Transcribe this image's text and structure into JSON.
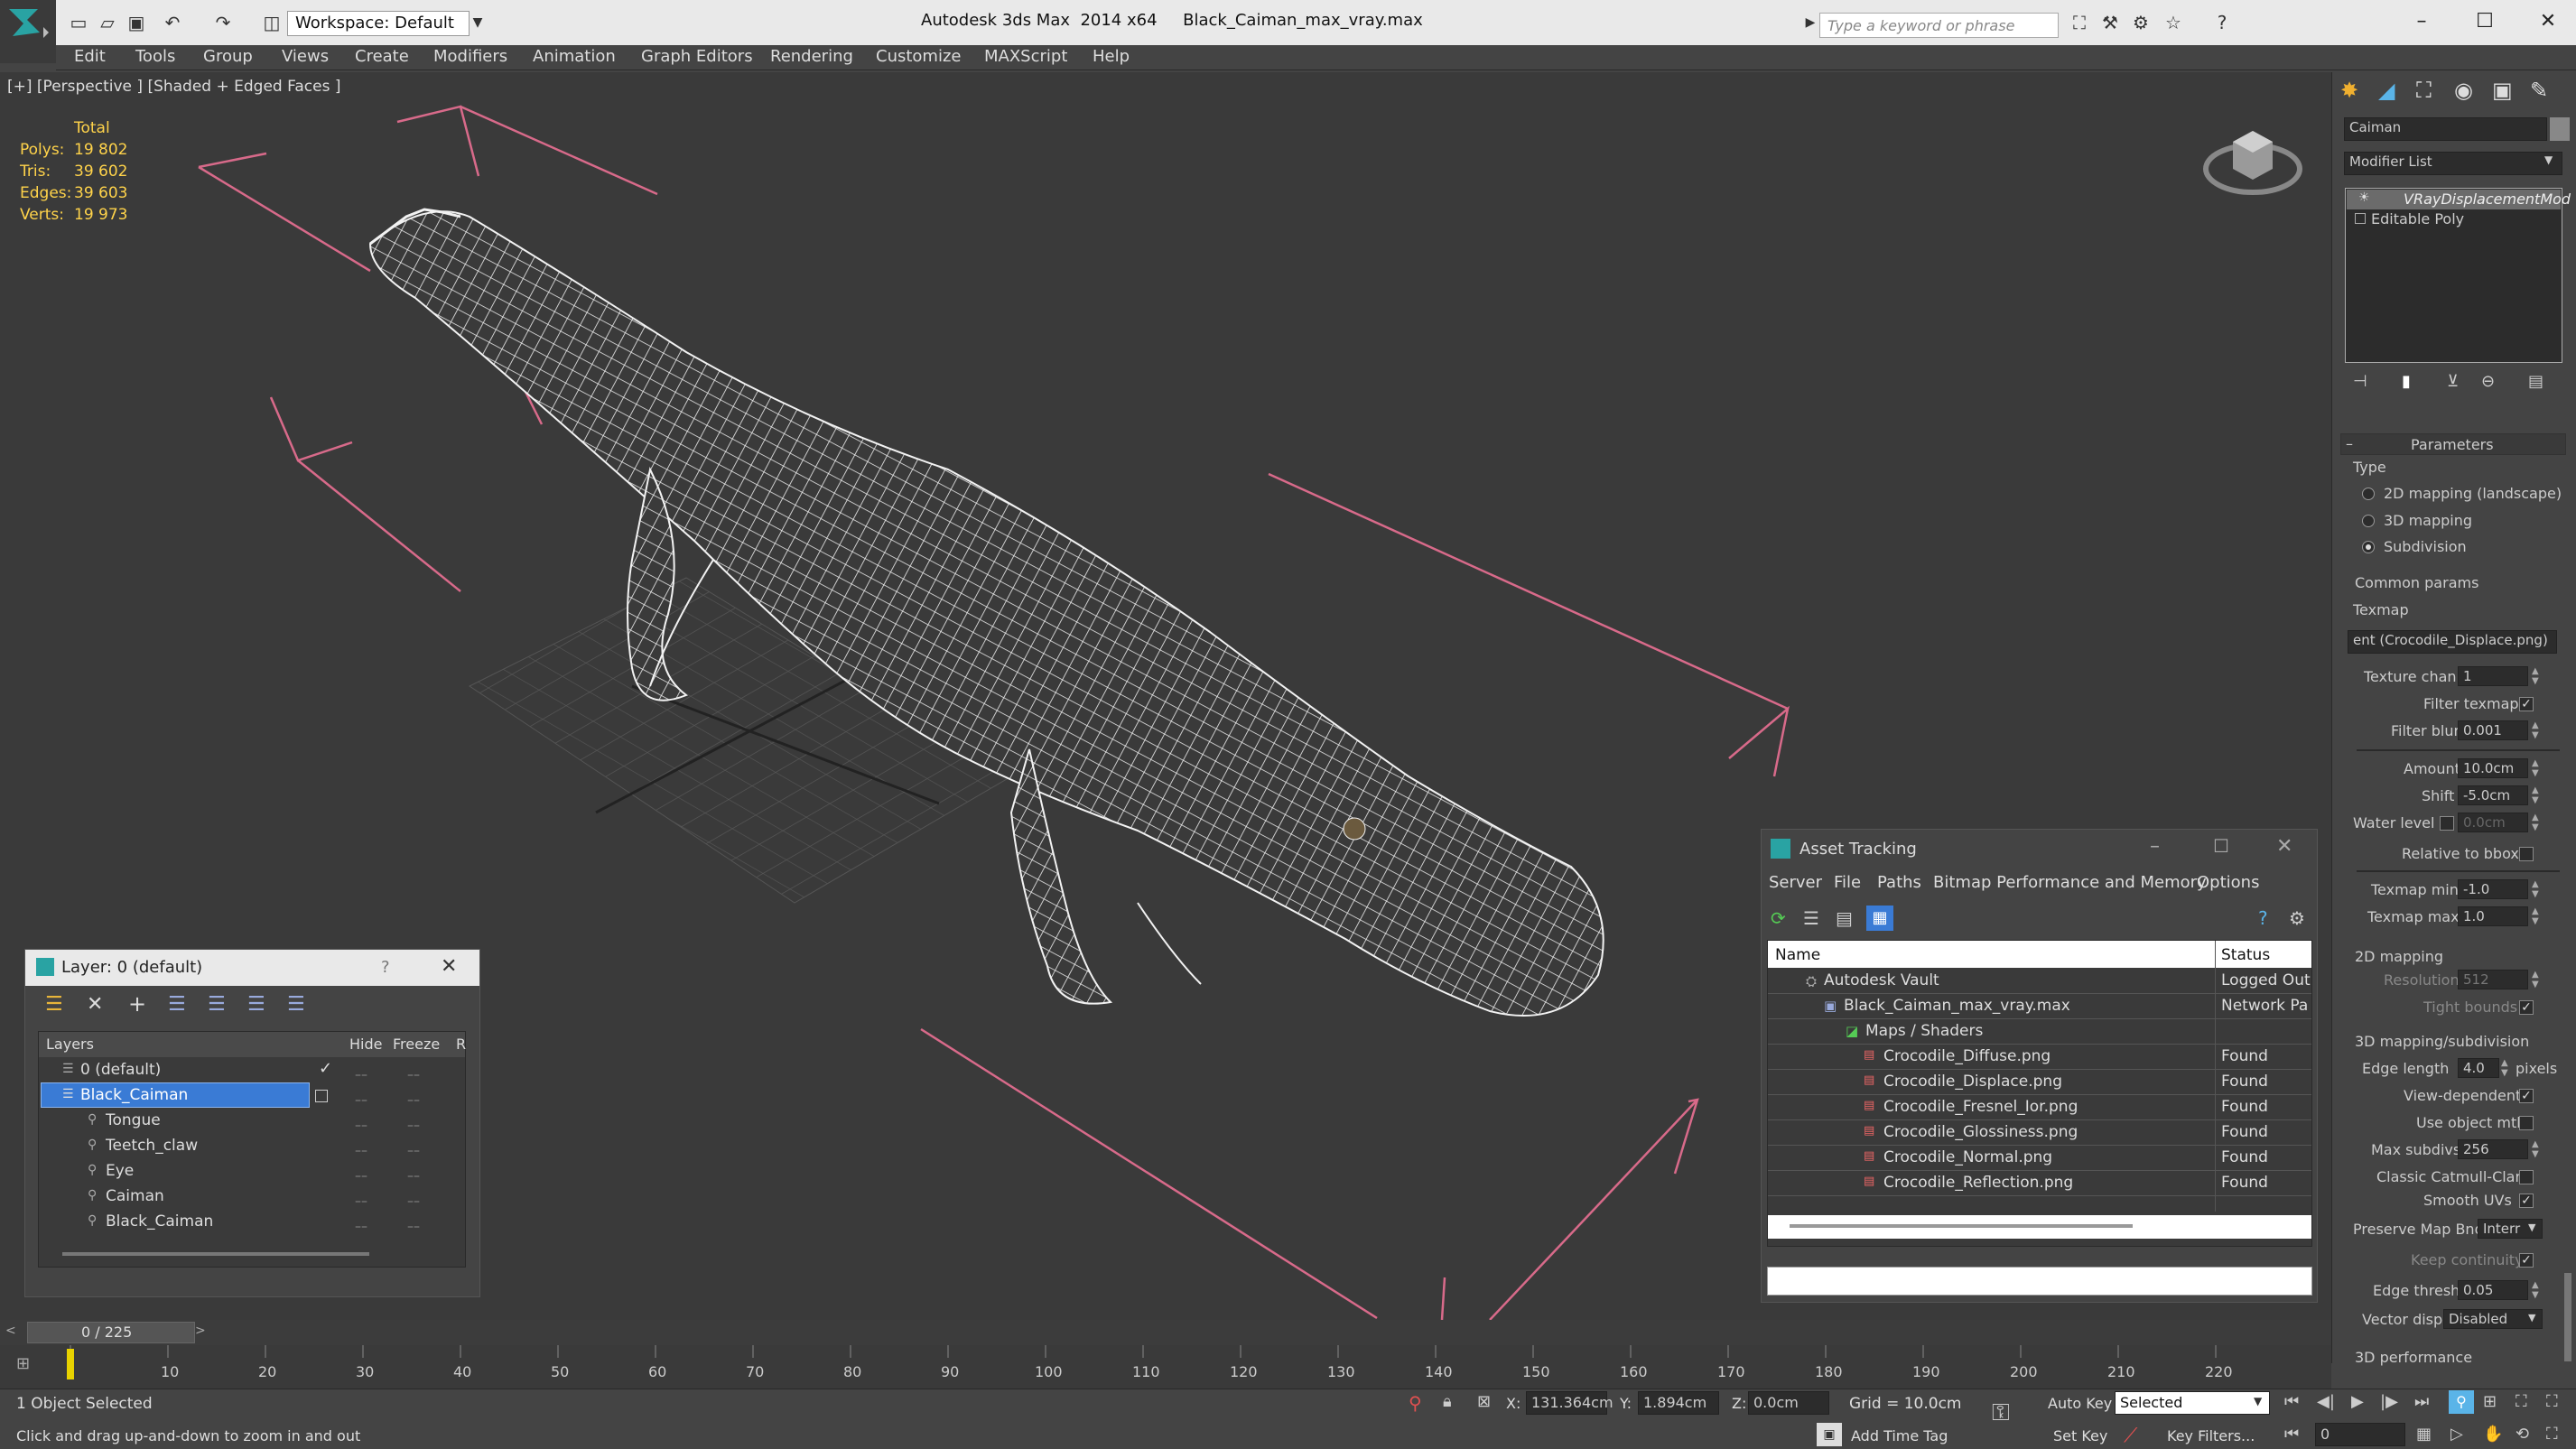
{
  "window": {
    "app_title": "Autodesk 3ds Max  2014 x64",
    "file_title": "Black_Caiman_max_vray.max",
    "workspace": "Workspace: Default",
    "search_placeholder": "Type a keyword or phrase"
  },
  "menu": [
    "Edit",
    "Tools",
    "Group",
    "Views",
    "Create",
    "Modifiers",
    "Animation",
    "Graph Editors",
    "Rendering",
    "Customize",
    "MAXScript",
    "Help"
  ],
  "viewport": {
    "label": "[+] [Perspective ] [Shaded + Edged Faces ]",
    "stats_header": "Total",
    "stats": [
      {
        "label": "Polys:",
        "value": "19 802"
      },
      {
        "label": "Tris:",
        "value": "39 602"
      },
      {
        "label": "Edges:",
        "value": "39 603"
      },
      {
        "label": "Verts:",
        "value": "19 973"
      }
    ]
  },
  "command_panel": {
    "object_name": "Caiman",
    "modifier_list": "Modifier List",
    "stack": [
      "VRayDisplacementMod",
      "Editable Poly"
    ],
    "rollout_title": "Parameters",
    "type_label": "Type",
    "type_options": [
      "2D mapping (landscape)",
      "3D mapping",
      "Subdivision"
    ],
    "common_params": "Common params",
    "texmap_label": "Texmap",
    "texmap_value": "ent (Crocodile_Displace.png)",
    "texture_chan_label": "Texture chan",
    "texture_chan": "1",
    "filter_texmap": "Filter texmap",
    "filter_blur_label": "Filter blur",
    "filter_blur": "0.001",
    "amount_label": "Amount",
    "amount": "10.0cm",
    "shift_label": "Shift",
    "shift": "-5.0cm",
    "water_level_label": "Water level",
    "water_level": "0.0cm",
    "relative_bbox": "Relative to bbox",
    "texmap_min_label": "Texmap min",
    "texmap_min": "-1.0",
    "texmap_max_label": "Texmap max",
    "texmap_max": "1.0",
    "mapping_2d": "2D mapping",
    "resolution_label": "Resolution",
    "resolution": "512",
    "tight_bounds": "Tight bounds",
    "mapping_3d": "3D mapping/subdivision",
    "edge_length_label": "Edge length",
    "edge_length": "4.0",
    "pixels": "pixels",
    "view_dependent": "View-dependent",
    "use_object_mtl": "Use object mtl",
    "max_subdivs_label": "Max subdivs",
    "max_subdivs": "256",
    "classic_catmull": "Classic Catmull-Clark",
    "smooth_uvs": "Smooth UVs",
    "preserve_map_label": "Preserve Map Bnd",
    "preserve_map": "Interr",
    "keep_continuity": "Keep continuity",
    "edge_thresh_label": "Edge thresh",
    "edge_thresh": "0.05",
    "vector_displ_label": "Vector displ",
    "vector_displ": "Disabled",
    "performance": "3D performance"
  },
  "layer_dialog": {
    "title": "Layer: 0 (default)",
    "help": "?",
    "columns": [
      "Layers",
      "Hide",
      "Freeze",
      "R"
    ],
    "rows": [
      {
        "name": "0 (default)",
        "indent": 1
      },
      {
        "name": "Black_Caiman",
        "indent": 1
      },
      {
        "name": "Tongue",
        "indent": 2
      },
      {
        "name": "Teetch_claw",
        "indent": 2
      },
      {
        "name": "Eye",
        "indent": 2
      },
      {
        "name": "Caiman",
        "indent": 2
      },
      {
        "name": "Black_Caiman",
        "indent": 2
      }
    ]
  },
  "asset_dialog": {
    "title": "Asset Tracking",
    "menu": [
      "Server",
      "File",
      "Paths",
      "Bitmap Performance and Memory",
      "Options"
    ],
    "columns": [
      "Name",
      "Status"
    ],
    "rows": [
      {
        "name": "Autodesk Vault",
        "status": "Logged Out",
        "indent": 1
      },
      {
        "name": "Black_Caiman_max_vray.max",
        "status": "Network Pa",
        "indent": 2
      },
      {
        "name": "Maps / Shaders",
        "status": "",
        "indent": 3
      },
      {
        "name": "Crocodile_Diffuse.png",
        "status": "Found",
        "indent": 4
      },
      {
        "name": "Crocodile_Displace.png",
        "status": "Found",
        "indent": 4
      },
      {
        "name": "Crocodile_Fresnel_Ior.png",
        "status": "Found",
        "indent": 4
      },
      {
        "name": "Crocodile_Glossiness.png",
        "status": "Found",
        "indent": 4
      },
      {
        "name": "Crocodile_Normal.png",
        "status": "Found",
        "indent": 4
      },
      {
        "name": "Crocodile_Reflection.png",
        "status": "Found",
        "indent": 4
      }
    ]
  },
  "timeline": {
    "frame": "0 / 225",
    "ticks": [
      "10",
      "20",
      "30",
      "40",
      "50",
      "60",
      "70",
      "80",
      "90",
      "100",
      "110",
      "120",
      "130",
      "140",
      "150",
      "160",
      "170",
      "180",
      "190",
      "200",
      "210",
      "220"
    ]
  },
  "status": {
    "selected": "1 Object Selected",
    "hint": "Click and drag up-and-down to zoom in and out",
    "x_label": "X:",
    "x": "131.364cm",
    "y_label": "Y:",
    "y": "1.894cm",
    "z_label": "Z:",
    "z": "0.0cm",
    "grid": "Grid = 10.0cm",
    "auto_key": "Auto Key",
    "selected_dropdown": "Selected",
    "set_key": "Set Key",
    "key_filters": "Key Filters...",
    "add_time_tag": "Add Time Tag",
    "frame_field": "0"
  },
  "colors": {
    "stats": "#ffd34a",
    "selection": "#3a7bd5",
    "wire": "#f2f2f2",
    "gizmo": "#d86a8a"
  }
}
